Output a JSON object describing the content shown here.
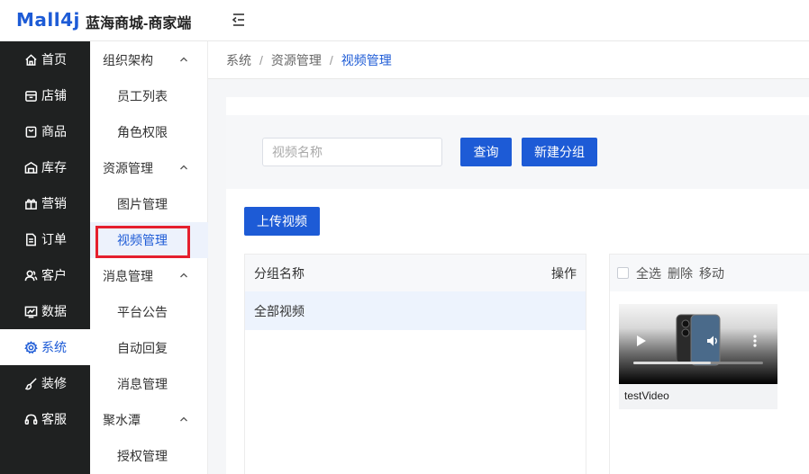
{
  "header": {
    "logo_text": "Mall4j",
    "app_title": "蓝海商城-商家端",
    "brand_color": "#1d5bd6"
  },
  "sidebar": {
    "items": [
      {
        "label": "首页",
        "icon": "home-icon"
      },
      {
        "label": "店铺",
        "icon": "store-icon"
      },
      {
        "label": "商品",
        "icon": "bag-icon"
      },
      {
        "label": "库存",
        "icon": "warehouse-icon"
      },
      {
        "label": "营销",
        "icon": "gift-icon"
      },
      {
        "label": "订单",
        "icon": "document-icon"
      },
      {
        "label": "客户",
        "icon": "users-icon"
      },
      {
        "label": "数据",
        "icon": "chart-icon"
      },
      {
        "label": "系统",
        "icon": "gear-icon",
        "active": true
      },
      {
        "label": "装修",
        "icon": "brush-icon"
      },
      {
        "label": "客服",
        "icon": "headset-icon"
      }
    ]
  },
  "submenu": {
    "groups": [
      {
        "label": "组织架构",
        "items": [
          "员工列表",
          "角色权限"
        ]
      },
      {
        "label": "资源管理",
        "items": [
          "图片管理",
          "视频管理"
        ]
      },
      {
        "label": "消息管理",
        "items": [
          "平台公告",
          "自动回复",
          "消息管理"
        ]
      },
      {
        "label": "聚水潭",
        "items": [
          "授权管理"
        ]
      }
    ],
    "active_item": "视频管理"
  },
  "breadcrumb": [
    "系统",
    "资源管理",
    "视频管理"
  ],
  "filter": {
    "search_placeholder": "视频名称",
    "query_label": "查询",
    "new_group_label": "新建分组"
  },
  "upload_label": "上传视频",
  "group_table": {
    "col_name": "分组名称",
    "col_action": "操作",
    "rows": [
      "全部视频"
    ]
  },
  "video_toolbar": {
    "select_all": "全选",
    "delete": "删除",
    "move": "移动"
  },
  "videos": [
    {
      "name": "testVideo"
    }
  ]
}
